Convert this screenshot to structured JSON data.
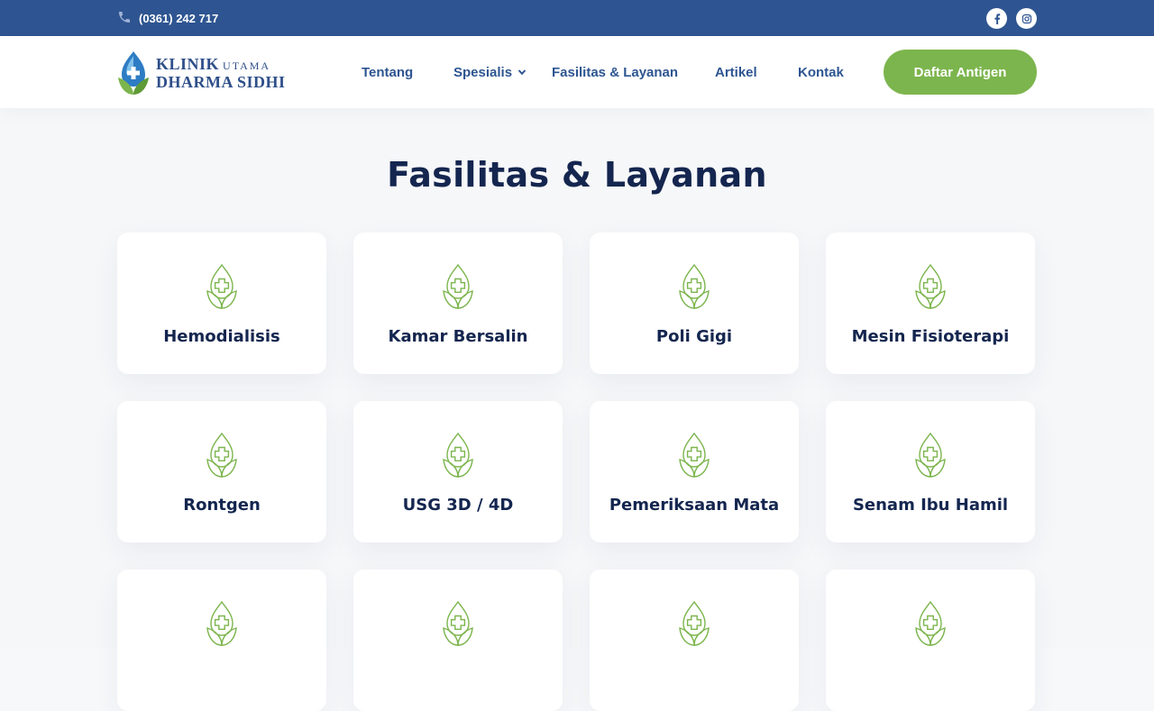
{
  "topbar": {
    "phone": "(0361) 242 717",
    "phone_icon": "phone-icon",
    "social": [
      "facebook-icon",
      "instagram-icon"
    ]
  },
  "header": {
    "logo": {
      "line1": "KLINIK",
      "line1_small": "UTAMA",
      "line2": "DHARMA SIDHI"
    },
    "nav": [
      {
        "label": "Tentang"
      },
      {
        "label": "Spesialis"
      },
      {
        "label": "Fasilitas & Layanan"
      },
      {
        "label": "Artikel"
      },
      {
        "label": "Kontak"
      }
    ],
    "cta": "Daftar Antigen"
  },
  "main": {
    "title": "Fasilitas & Layanan",
    "cards": [
      {
        "label": "Hemodialisis"
      },
      {
        "label": "Kamar Bersalin"
      },
      {
        "label": "Poli Gigi"
      },
      {
        "label": "Mesin Fisioterapi"
      },
      {
        "label": "Rontgen"
      },
      {
        "label": "USG 3D / 4D"
      },
      {
        "label": "Pemeriksaan Mata"
      },
      {
        "label": "Senam Ibu Hamil"
      },
      {
        "label": ""
      },
      {
        "label": ""
      },
      {
        "label": ""
      },
      {
        "label": ""
      }
    ]
  },
  "colors": {
    "topbar": "#2e5591",
    "nav_text": "#2e5591",
    "accent_green": "#7cb54d",
    "heading": "#14264f",
    "logo_blue": "#2e4f8a"
  }
}
